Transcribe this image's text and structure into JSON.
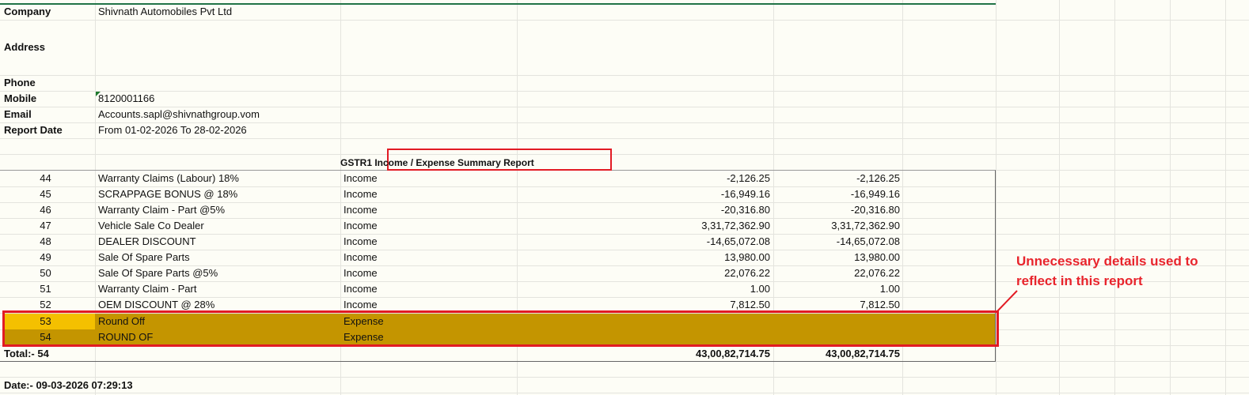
{
  "header": {
    "fields": [
      {
        "label": "Company",
        "value": "Shivnath Automobiles Pvt Ltd"
      },
      {
        "label": "Address",
        "value": ""
      },
      {
        "label": "Phone",
        "value": ""
      },
      {
        "label": "Mobile",
        "value": "8120001166"
      },
      {
        "label": "Email",
        "value": "Accounts.sapl@shivnathgroup.vom"
      },
      {
        "label": "Report Date",
        "value": "From 01-02-2026 To 28-02-2026"
      }
    ]
  },
  "report_title": "GSTR1 Income / Expense Summary Report",
  "rows": [
    {
      "no": "44",
      "name": "Warranty Claims (Labour) 18%",
      "type": "Income",
      "amount1": "-2,126.25",
      "amount2": "-2,126.25"
    },
    {
      "no": "45",
      "name": "SCRAPPAGE BONUS @ 18%",
      "type": "Income",
      "amount1": "-16,949.16",
      "amount2": "-16,949.16"
    },
    {
      "no": "46",
      "name": "Warranty Claim - Part @5%",
      "type": "Income",
      "amount1": "-20,316.80",
      "amount2": "-20,316.80"
    },
    {
      "no": "47",
      "name": "Vehicle Sale Co Dealer",
      "type": "Income",
      "amount1": "3,31,72,362.90",
      "amount2": "3,31,72,362.90"
    },
    {
      "no": "48",
      "name": "DEALER DISCOUNT",
      "type": "Income",
      "amount1": "-14,65,072.08",
      "amount2": "-14,65,072.08"
    },
    {
      "no": "49",
      "name": "Sale Of Spare Parts",
      "type": "Income",
      "amount1": "13,980.00",
      "amount2": "13,980.00"
    },
    {
      "no": "50",
      "name": "Sale Of Spare Parts @5%",
      "type": "Income",
      "amount1": "22,076.22",
      "amount2": "22,076.22"
    },
    {
      "no": "51",
      "name": "Warranty Claim - Part",
      "type": "Income",
      "amount1": "1.00",
      "amount2": "1.00"
    },
    {
      "no": "52",
      "name": "OEM DISCOUNT @ 28%",
      "type": "Income",
      "amount1": "7,812.50",
      "amount2": "7,812.50"
    },
    {
      "no": "53",
      "name": "Round Off",
      "type": "Expense",
      "amount1": "",
      "amount2": ""
    },
    {
      "no": "54",
      "name": "ROUND OF",
      "type": "Expense",
      "amount1": "",
      "amount2": ""
    }
  ],
  "total": {
    "label": "Total:- 54",
    "amount1": "43,00,82,714.75",
    "amount2": "43,00,82,714.75"
  },
  "footer_date": "Date:- 09-03-2026 07:29:13",
  "annotation": {
    "line1": "Unnecessary details used to",
    "line2": "reflect in this report",
    "color": "#e8242c"
  },
  "colors": {
    "highlight": "#c49500",
    "active_cell": "#f4c000"
  }
}
